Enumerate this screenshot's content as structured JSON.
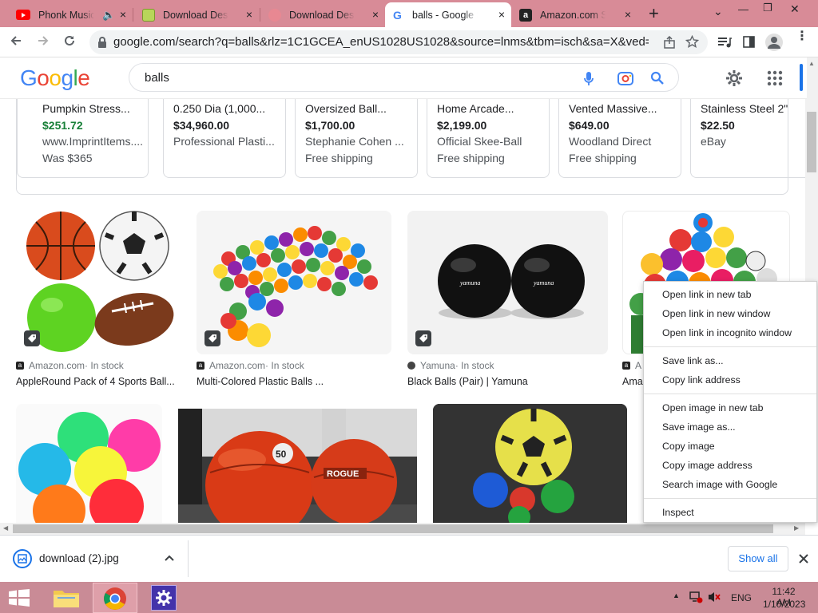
{
  "tabs": [
    {
      "title": "Phonk Music",
      "close": "×",
      "favicon": "youtube-icon"
    },
    {
      "title": "Download Desktop",
      "close": "×",
      "favicon": "tab-favicon"
    },
    {
      "title": "Download Desktop",
      "close": "×",
      "favicon": "tab-favicon"
    },
    {
      "title": "balls - Google Search",
      "close": "×",
      "favicon": "google-icon"
    },
    {
      "title": "Amazon.com Shopping",
      "close": "×",
      "favicon": "amazon-icon"
    }
  ],
  "new_tab": "+",
  "window_controls": {
    "down": "⌄",
    "minimize": "—",
    "restore": "❐",
    "close": "✕"
  },
  "address": {
    "url": "google.com/search?q=balls&rlz=1C1GCEA_enUS1028US1028&source=lnms&tbm=isch&sa=X&ved=2ahU..."
  },
  "google": {
    "logo": [
      "G",
      "o",
      "o",
      "g",
      "l",
      "e"
    ],
    "logo_colors": [
      "#4285f4",
      "#ea4335",
      "#fbbc05",
      "#4285f4",
      "#34a853",
      "#ea4335"
    ],
    "query": "balls"
  },
  "shopping_cards": [
    {
      "name": "Pumpkin Stress...",
      "price": "$251.72",
      "seller": "www.ImprintItems....",
      "extra": "Was $365",
      "sale": true
    },
    {
      "name": "0.250 Dia (1,000...",
      "price": "$34,960.00",
      "seller": "Professional Plasti...",
      "extra": "",
      "sale": false
    },
    {
      "name": "Oversized Ball...",
      "price": "$1,700.00",
      "seller": "Stephanie Cohen ...",
      "extra": "Free shipping",
      "sale": false
    },
    {
      "name": "Home Arcade...",
      "price": "$2,199.00",
      "seller": "Official Skee-Ball",
      "extra": "Free shipping",
      "sale": false
    },
    {
      "name": "Vented Massive...",
      "price": "$649.00",
      "seller": "Woodland Direct",
      "extra": "Free shipping",
      "sale": false
    },
    {
      "name": "Stainless Steel 2\"",
      "price": "$22.50",
      "seller": "eBay",
      "extra": "",
      "sale": false
    }
  ],
  "results": [
    {
      "source": "Amazon.com",
      "stock": " · In stock",
      "title": "AppleRound Pack of 4 Sports Ball..."
    },
    {
      "source": "Amazon.com",
      "stock": " · In stock",
      "title": "Multi-Colored Plastic Balls ..."
    },
    {
      "source": "Yamuna",
      "stock": " · In stock",
      "title": "Black Balls (Pair) | Yamuna"
    },
    {
      "source": "A",
      "stock": "",
      "title": "Ama"
    }
  ],
  "product_text": {
    "yamuna": "yamuna",
    "rogue": "ROGUE",
    "fifty": "50"
  },
  "context_menu": {
    "group1": [
      "Open link in new tab",
      "Open link in new window",
      "Open link in incognito window"
    ],
    "group2": [
      "Save link as...",
      "Copy link address"
    ],
    "group3": [
      "Open image in new tab",
      "Save image as...",
      "Copy image",
      "Copy image address",
      "Search image with Google"
    ],
    "group4": [
      "Inspect"
    ]
  },
  "download": {
    "filename": "download (2).jpg",
    "show_all": "Show all"
  },
  "taskbar": {
    "lang": "ENG",
    "time": "11:42 AM",
    "date": "1/10/2023"
  }
}
